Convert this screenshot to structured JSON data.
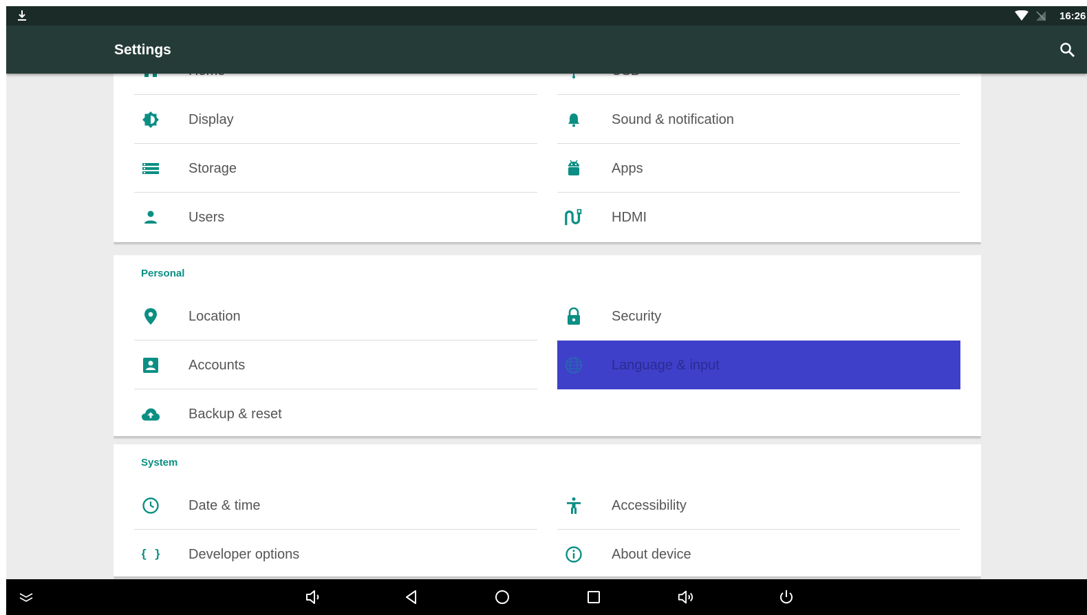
{
  "status_bar": {
    "time": "16:26",
    "icons": [
      "download-icon",
      "wifi-icon",
      "no-sim-icon"
    ]
  },
  "app_bar": {
    "title": "Settings",
    "search_icon": "search-icon"
  },
  "colors": {
    "accent": "#0b8f84",
    "app_bar": "#253b37",
    "status_bar": "#1b2b27",
    "selected_row": "#3f40c9",
    "background": "#ececec"
  },
  "sections": {
    "device": {
      "items": [
        {
          "label": "Home",
          "icon": "home-icon"
        },
        {
          "label": "USB",
          "icon": "usb-icon"
        },
        {
          "label": "Display",
          "icon": "brightness-icon"
        },
        {
          "label": "Sound & notification",
          "icon": "bell-icon"
        },
        {
          "label": "Storage",
          "icon": "storage-icon"
        },
        {
          "label": "Apps",
          "icon": "android-icon"
        },
        {
          "label": "Users",
          "icon": "person-icon"
        },
        {
          "label": "HDMI",
          "icon": "hdmi-icon"
        }
      ]
    },
    "personal": {
      "title": "Personal",
      "items": [
        {
          "label": "Location",
          "icon": "location-pin-icon"
        },
        {
          "label": "Security",
          "icon": "lock-icon"
        },
        {
          "label": "Accounts",
          "icon": "account-box-icon"
        },
        {
          "label": "Language & input",
          "icon": "globe-icon",
          "selected": true
        },
        {
          "label": "Backup & reset",
          "icon": "cloud-upload-icon"
        }
      ]
    },
    "system": {
      "title": "System",
      "items": [
        {
          "label": "Date & time",
          "icon": "clock-icon"
        },
        {
          "label": "Accessibility",
          "icon": "accessibility-icon"
        },
        {
          "label": "Developer options",
          "icon": "braces-icon"
        },
        {
          "label": "About device",
          "icon": "info-icon"
        }
      ]
    }
  },
  "nav_bar": {
    "buttons": [
      "collapse-icon",
      "volume-down-icon",
      "back-icon",
      "home-circle-icon",
      "recents-icon",
      "volume-up-icon",
      "power-icon"
    ]
  }
}
